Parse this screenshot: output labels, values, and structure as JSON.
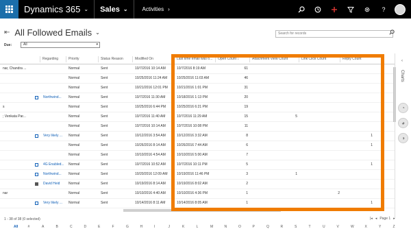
{
  "nav": {
    "app_title": "Dynamics 365",
    "app_chevron": "⌄",
    "area": "Sales",
    "area_chevron": "⌄",
    "breadcrumb": "Activities",
    "breadcrumb_arrow": "›",
    "icons": [
      "search-icon",
      "history-icon",
      "add-icon",
      "filter-icon",
      "settings-icon",
      "help-icon"
    ]
  },
  "view": {
    "title": "All Followed Emails",
    "chevron": "⌄",
    "search_placeholder": "Search for records",
    "filter_label": "Due:",
    "filter_value": "All",
    "filter_arrow": "▾"
  },
  "columns": [
    {
      "key": "regarding",
      "label": "Regarding"
    },
    {
      "key": "priority",
      "label": "Priority"
    },
    {
      "key": "status",
      "label": "Status Reason"
    },
    {
      "key": "modified",
      "label": "Modified On"
    },
    {
      "key": "last_opened",
      "label": "Last time email was o..."
    },
    {
      "key": "open_count",
      "label": "Open Count ↓"
    },
    {
      "key": "attach_count",
      "label": "Attachment View Count"
    },
    {
      "key": "link_count",
      "label": "Link Click Count"
    },
    {
      "key": "reply_count",
      "label": "Reply Count"
    }
  ],
  "rows": [
    {
      "from": "nar, Chandra ...",
      "regarding": "",
      "priority": "Normal",
      "status": "Sent",
      "modified": "10/7/2016 10:14 AM",
      "last_opened": "10/7/2016 8:19 AM",
      "open_count": "61",
      "attach_count": "",
      "link_count": "",
      "reply_count": ""
    },
    {
      "from": "",
      "regarding": "",
      "priority": "Normal",
      "status": "Sent",
      "modified": "10/25/2016 11:24 AM",
      "last_opened": "10/25/2016 11:03 AM",
      "open_count": "46",
      "attach_count": "",
      "link_count": "",
      "reply_count": ""
    },
    {
      "from": "",
      "regarding": "",
      "priority": "Normal",
      "status": "Sent",
      "modified": "10/21/2016 12:01 PM",
      "last_opened": "10/21/2016 1:01 PM",
      "open_count": "31",
      "attach_count": "",
      "link_count": "",
      "reply_count": ""
    },
    {
      "from": "",
      "regarding": "Northwind...",
      "priority": "Normal",
      "status": "Sent",
      "modified": "10/7/2016 11:30 AM",
      "last_opened": "10/18/2016 1:13 PM",
      "open_count": "20",
      "attach_count": "",
      "link_count": "",
      "reply_count": ""
    },
    {
      "from": "s",
      "regarding": "",
      "priority": "Normal",
      "status": "Sent",
      "modified": "10/25/2016 6:44 PM",
      "last_opened": "10/25/2016 6:21 PM",
      "open_count": "19",
      "attach_count": "",
      "link_count": "",
      "reply_count": ""
    },
    {
      "from": "; Venkata Par...",
      "regarding": "",
      "priority": "Normal",
      "status": "Sent",
      "modified": "10/7/2016 11:40 AM",
      "last_opened": "10/7/2016 11:29 AM",
      "open_count": "15",
      "attach_count": "5",
      "link_count": "",
      "reply_count": ""
    },
    {
      "from": "",
      "regarding": "",
      "priority": "Normal",
      "status": "Sent",
      "modified": "10/7/2016 10:14 AM",
      "last_opened": "10/7/2016 10:08 PM",
      "open_count": "11",
      "attach_count": "",
      "link_count": "",
      "reply_count": ""
    },
    {
      "from": "",
      "regarding": "Very likely ...",
      "priority": "Normal",
      "status": "Sent",
      "modified": "10/12/2016 3:54 AM",
      "last_opened": "10/12/2016 3:32 AM",
      "open_count": "8",
      "attach_count": "",
      "link_count": "",
      "reply_count": "1"
    },
    {
      "from": "",
      "regarding": "",
      "priority": "Normal",
      "status": "Sent",
      "modified": "10/26/2016 8:14 AM",
      "last_opened": "10/26/2016 7:44 AM",
      "open_count": "6",
      "attach_count": "",
      "link_count": "",
      "reply_count": "1"
    },
    {
      "from": "",
      "regarding": "",
      "priority": "Normal",
      "status": "Sent",
      "modified": "10/10/2016 4:54 AM",
      "last_opened": "10/10/2016 5:00 AM",
      "open_count": "7",
      "attach_count": "",
      "link_count": "",
      "reply_count": ""
    },
    {
      "from": "",
      "regarding": "4G Enabled...",
      "priority": "Normal",
      "status": "Sent",
      "modified": "10/7/2016 10:52 AM",
      "last_opened": "10/7/2016 10:11 PM",
      "open_count": "5",
      "attach_count": "",
      "link_count": "",
      "reply_count": "1"
    },
    {
      "from": "",
      "regarding": "Northwind...",
      "priority": "Normal",
      "status": "Sent",
      "modified": "10/20/2016 12:09 AM",
      "last_opened": "10/19/2016 11:46 PM",
      "open_count": "3",
      "attach_count": "1",
      "link_count": "",
      "reply_count": ""
    },
    {
      "from": "",
      "regarding": "David Heid",
      "priority": "Normal",
      "status": "Sent",
      "modified": "10/19/2016 8:14 AM",
      "last_opened": "10/19/2016 8:02 AM",
      "open_count": "2",
      "attach_count": "",
      "link_count": "",
      "reply_count": ""
    },
    {
      "from": "nar",
      "regarding": "",
      "priority": "Normal",
      "status": "Sent",
      "modified": "10/10/2016 4:40 AM",
      "last_opened": "10/10/2016 4:36 PM",
      "open_count": "1",
      "attach_count": "",
      "link_count": "2",
      "reply_count": ""
    },
    {
      "from": "",
      "regarding": "Very likely ...",
      "priority": "Normal",
      "status": "Sent",
      "modified": "10/14/2016 8:11 AM",
      "last_opened": "10/14/2016 8:05 AM",
      "open_count": "1",
      "attach_count": "",
      "link_count": "",
      "reply_count": "1"
    }
  ],
  "side_panel": {
    "label": "Charts",
    "arrow": "‹"
  },
  "footer": {
    "status": "1 - 38 of 38 (0 selected)",
    "pager_first": "|◂",
    "pager_prev": "◂",
    "pager_page": "Page 1",
    "pager_next": "▸"
  },
  "alphabet": [
    "All",
    "#",
    "A",
    "B",
    "C",
    "D",
    "E",
    "F",
    "G",
    "H",
    "I",
    "J",
    "K",
    "L",
    "M",
    "N",
    "O",
    "P",
    "Q",
    "R",
    "S",
    "T",
    "U",
    "V",
    "W",
    "X",
    "Y",
    "Z"
  ],
  "colors": {
    "highlight": "#f07c00",
    "brand": "#1b6eaa",
    "link": "#1160b7",
    "add": "#e53935"
  }
}
